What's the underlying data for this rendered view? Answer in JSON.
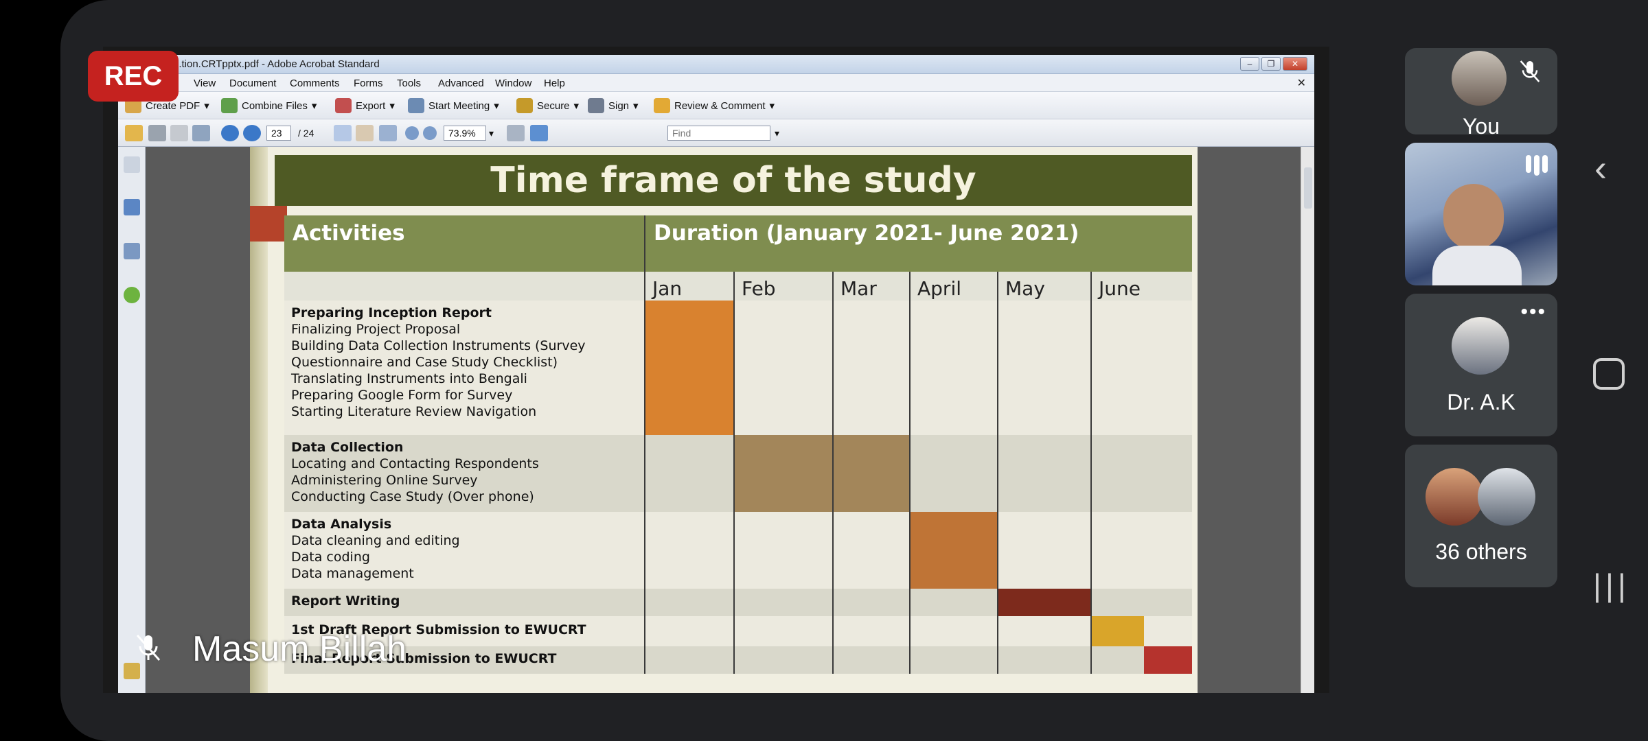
{
  "meeting": {
    "rec_label": "REC",
    "presenter_name": "Masum Billah",
    "participants": [
      {
        "name": "You",
        "muted": true
      },
      {
        "name": "Dr. A.K"
      },
      {
        "name": "36 others"
      }
    ]
  },
  "acrobat": {
    "window_title": "...tion.CRTpptx.pdf - Adobe Acrobat Standard",
    "menu": [
      "View",
      "Document",
      "Comments",
      "Forms",
      "Tools",
      "Advanced",
      "Window",
      "Help"
    ],
    "toolbar": [
      "Create PDF",
      "Combine Files",
      "Export",
      "Start Meeting",
      "Secure",
      "Sign",
      "Review & Comment"
    ],
    "page_current": "23",
    "page_total": "/ 24",
    "zoom": "73.9%",
    "find_placeholder": "Find"
  },
  "slide": {
    "title": "Time frame of the study",
    "activities_header": "Activities",
    "duration_header": "Duration (January 2021- June 2021)",
    "months": [
      "Jan",
      "Feb",
      "Mar",
      "April",
      "May",
      "June"
    ],
    "rows": [
      {
        "heading": "Preparing Inception Report",
        "items": [
          "Finalizing Project Proposal",
          "Building Data Collection Instruments (Survey",
          "Questionnaire and Case Study Checklist)",
          "Translating Instruments into Bengali",
          "Preparing Google Form for Survey",
          "Starting Literature Review Navigation"
        ]
      },
      {
        "heading": "Data Collection",
        "items": [
          "Locating and Contacting Respondents",
          "Administering Online Survey",
          "Conducting Case Study (Over phone)"
        ]
      },
      {
        "heading": "Data Analysis",
        "items": [
          "Data cleaning and editing",
          "Data coding",
          "Data management"
        ]
      },
      {
        "heading": "Report Writing",
        "items": []
      },
      {
        "heading": "1st Draft Report Submission to EWUCRT",
        "items": []
      },
      {
        "heading": "Final Report Submission to EWUCRT",
        "items": []
      }
    ],
    "colors": {
      "jan": "#d9822f",
      "febmar": "#a3865a",
      "april": "#bf7436",
      "may": "#7d2a1c",
      "june_half": "#d9a52a",
      "june_final": "#b5332d"
    }
  }
}
